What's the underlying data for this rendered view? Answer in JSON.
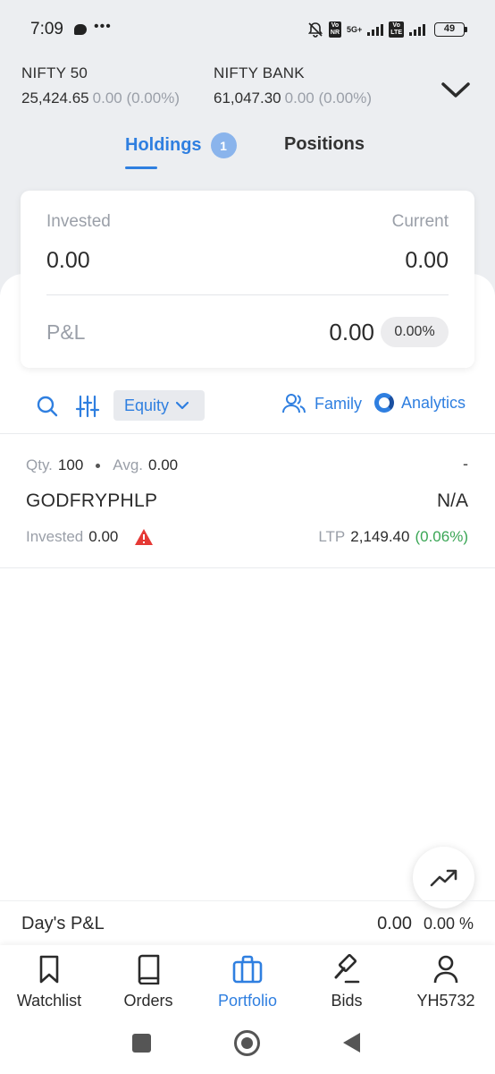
{
  "status_bar": {
    "time": "7:09",
    "battery": "49",
    "network": "5G+"
  },
  "indices": [
    {
      "name": "NIFTY 50",
      "value": "25,424.65",
      "change": "0.00 (0.00%)"
    },
    {
      "name": "NIFTY BANK",
      "value": "61,047.30",
      "change": "0.00 (0.00%)"
    }
  ],
  "tabs": {
    "holdings_label": "Holdings",
    "holdings_count": "1",
    "positions_label": "Positions"
  },
  "summary": {
    "invested_label": "Invested",
    "invested_value": "0.00",
    "current_label": "Current",
    "current_value": "0.00",
    "pl_label": "P&L",
    "pl_value": "0.00",
    "pl_percent": "0.00%"
  },
  "filters": {
    "segment": "Equity",
    "family_label": "Family",
    "analytics_label": "Analytics"
  },
  "holdings": [
    {
      "qty_label": "Qty.",
      "qty": "100",
      "avg_label": "Avg.",
      "avg": "0.00",
      "change": "-",
      "symbol": "GODFRYPHLP",
      "current": "N/A",
      "invested_label": "Invested",
      "invested": "0.00",
      "ltp_label": "LTP",
      "ltp": "2,149.40",
      "ltp_change": "(0.06%)"
    }
  ],
  "day_pl": {
    "label": "Day's P&L",
    "value": "0.00",
    "percent": "0.00 %"
  },
  "bottom_nav": [
    {
      "label": "Watchlist",
      "icon": "bookmark-icon"
    },
    {
      "label": "Orders",
      "icon": "book-icon"
    },
    {
      "label": "Portfolio",
      "icon": "briefcase-icon",
      "active": true
    },
    {
      "label": "Bids",
      "icon": "gavel-icon"
    },
    {
      "label": "YH5732",
      "icon": "user-icon"
    }
  ],
  "colors": {
    "accent": "#2f7fe0",
    "positive": "#3aa655",
    "warning": "#e53935",
    "muted": "#9a9fa8"
  }
}
